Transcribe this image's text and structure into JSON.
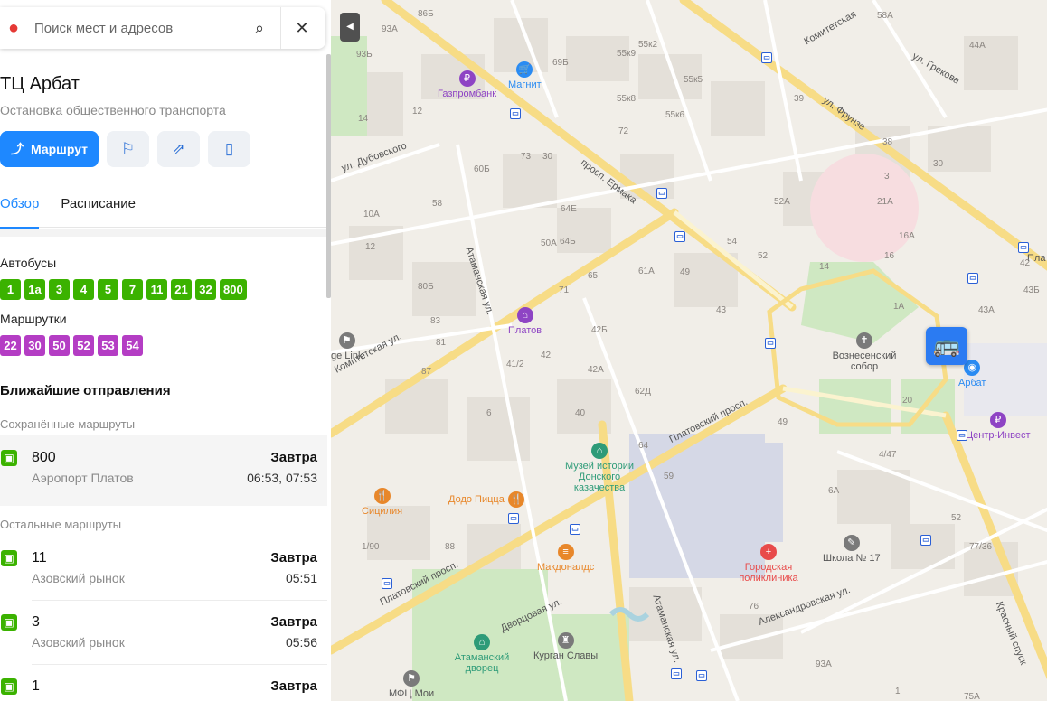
{
  "search": {
    "placeholder": "Поиск мест и адресов"
  },
  "place": {
    "title": "ТЦ Арбат",
    "subtitle": "Остановка общественного транспорта"
  },
  "actions": {
    "route_label": "Маршрут"
  },
  "tabs": [
    {
      "label": "Обзор",
      "active": true
    },
    {
      "label": "Расписание",
      "active": false
    }
  ],
  "buses": {
    "label": "Автобусы",
    "routes": [
      "1",
      "1а",
      "3",
      "4",
      "5",
      "7",
      "11",
      "21",
      "32",
      "800"
    ]
  },
  "minibuses": {
    "label": "Маршрутки",
    "routes": [
      "22",
      "30",
      "50",
      "52",
      "53",
      "54"
    ]
  },
  "departures": {
    "title": "Ближайшие отправления",
    "saved_label": "Сохранённые маршруты",
    "other_label": "Остальные маршруты",
    "saved": [
      {
        "route": "800",
        "destination": "Аэропорт Платов",
        "day": "Завтра",
        "times": "06:53, 07:53"
      }
    ],
    "other": [
      {
        "route": "11",
        "destination": "Азовский рынок",
        "day": "Завтра",
        "times": "05:51"
      },
      {
        "route": "3",
        "destination": "Азовский рынок",
        "day": "Завтра",
        "times": "05:56"
      },
      {
        "route": "1",
        "destination": "",
        "day": "Завтра",
        "times": ""
      }
    ]
  },
  "map": {
    "streets": [
      "просп. Ермака",
      "ул. Фрунзе",
      "Платовский просп.",
      "Платовский просп.",
      "Атаманская ул.",
      "Атаманская ул.",
      "Александровская ул.",
      "Дворцовая ул.",
      "Красный спуск",
      "ул. Дубовского",
      "Комитетская ул.",
      "ул. Грекова",
      "Комитетская",
      "Пла"
    ],
    "pois": [
      {
        "name": "Газпромбанк",
        "color": "#8e44c4",
        "icon": "bank-icon"
      },
      {
        "name": "Магнит",
        "color": "#2a8bf2",
        "icon": "shop-icon"
      },
      {
        "name": "Платов",
        "color": "#8e44c4",
        "icon": "hotel-icon"
      },
      {
        "name": "Вознесенский собор",
        "color": "#7a7a7a",
        "icon": "church-icon"
      },
      {
        "name": "Арбат",
        "color": "#2a8bf2",
        "icon": "mall-icon"
      },
      {
        "name": "Центр-Инвест",
        "color": "#8e44c4",
        "icon": "bank-icon"
      },
      {
        "name": "Музей истории Донского казачества",
        "color": "#2e9b78",
        "icon": "museum-icon"
      },
      {
        "name": "Додо Пицца",
        "color": "#e8872a",
        "icon": "food-icon"
      },
      {
        "name": "Сицилия",
        "color": "#e8872a",
        "icon": "food-icon"
      },
      {
        "name": "Макдоналдс",
        "color": "#e8872a",
        "icon": "burger-icon"
      },
      {
        "name": "Городская поликлиника",
        "color": "#e84a4a",
        "icon": "clinic-icon"
      },
      {
        "name": "Школа № 17",
        "color": "#7a7a7a",
        "icon": "school-icon"
      },
      {
        "name": "Атаманский дворец",
        "color": "#2e9b78",
        "icon": "museum-icon"
      },
      {
        "name": "Курган Славы",
        "color": "#7a7a7a",
        "icon": "monument-icon"
      },
      {
        "name": "МФЦ Мои",
        "color": "#7a7a7a",
        "icon": "office-icon"
      },
      {
        "name": "ge Link",
        "color": "#7a7a7a",
        "icon": "office-icon"
      }
    ],
    "house_numbers": [
      "86Б",
      "93А",
      "93Б",
      "69Б",
      "55к2",
      "55к9",
      "55к8",
      "55к5",
      "55к6",
      "14",
      "12",
      "72",
      "73",
      "30",
      "60Б",
      "58",
      "50А",
      "64Е",
      "64Б",
      "65",
      "71",
      "10А",
      "12",
      "80Б",
      "83",
      "81",
      "87",
      "41/2",
      "42",
      "42Б",
      "42А",
      "62Д",
      "40",
      "64",
      "6",
      "59",
      "49",
      "43",
      "52А",
      "54",
      "52",
      "61А",
      "21А",
      "16",
      "16А",
      "14",
      "42",
      "43Б",
      "43А",
      "1А",
      "20",
      "4/47",
      "6А",
      "49",
      "52",
      "77/36",
      "1/90",
      "88",
      "76",
      "93А",
      "75А",
      "58А",
      "44А",
      "39",
      "38",
      "30",
      "3",
      "1"
    ]
  }
}
